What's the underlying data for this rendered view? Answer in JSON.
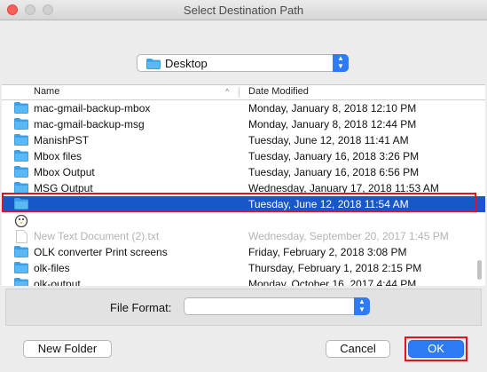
{
  "window": {
    "title": "Select Destination Path"
  },
  "location": {
    "selected": "Desktop"
  },
  "columns": {
    "name": "Name",
    "date": "Date Modified"
  },
  "files": [
    {
      "name": "mac-gmail-backup-mbox",
      "date": "Monday, January 8, 2018 12:10 PM",
      "icon": "folder-icon"
    },
    {
      "name": "mac-gmail-backup-msg",
      "date": "Monday, January 8, 2018 12:44 PM",
      "icon": "folder-icon"
    },
    {
      "name": "ManishPST",
      "date": "Tuesday, June 12, 2018 11:41 AM",
      "icon": "folder-icon"
    },
    {
      "name": "Mbox files",
      "date": "Tuesday, January 16, 2018 3:26 PM",
      "icon": "folder-icon"
    },
    {
      "name": "Mbox Output",
      "date": "Tuesday, January 16, 2018 6:56 PM",
      "icon": "folder-icon"
    },
    {
      "name": "MSG Output",
      "date": "Wednesday, January 17, 2018 11:53 AM",
      "icon": "folder-icon"
    },
    {
      "name": "",
      "date": "Tuesday, June 12, 2018 11:54 AM",
      "icon": "folder-icon",
      "selected": true
    },
    {
      "name": "",
      "date": "",
      "icon": "linux-app-icon"
    },
    {
      "name": "New Text Document (2).txt",
      "date": "Wednesday, September 20, 2017 1:45 PM",
      "icon": "text-file-icon",
      "dim": true
    },
    {
      "name": "OLK converter Print screens",
      "date": "Friday, February 2, 2018 3:08 PM",
      "icon": "folder-icon"
    },
    {
      "name": "olk-files",
      "date": "Thursday, February 1, 2018 2:15 PM",
      "icon": "folder-icon"
    },
    {
      "name": "olk-output",
      "date": "Monday, October 16, 2017 4:44 PM",
      "icon": "folder-icon"
    }
  ],
  "format": {
    "label": "File Format:",
    "value": ""
  },
  "buttons": {
    "new_folder": "New Folder",
    "cancel": "Cancel",
    "ok": "OK"
  },
  "colors": {
    "accent": "#2d7cf6",
    "selection": "#1757c9",
    "highlight_box": "#e0141e"
  }
}
